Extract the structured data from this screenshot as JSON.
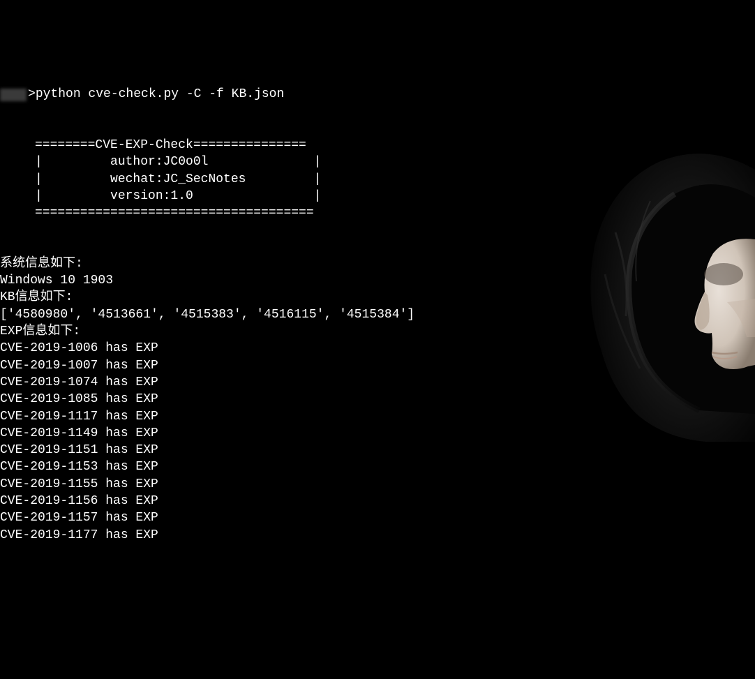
{
  "prompt": {
    "arrow": ">",
    "command": "python cve-check.py -C -f KB.json"
  },
  "banner": {
    "line1": "========CVE-EXP-Check===============",
    "line2": "|         author:JC0o0l              |",
    "line3": "|         wechat:JC_SecNotes         |",
    "line4": "|         version:1.0                |",
    "line5": "====================================="
  },
  "info": {
    "sysinfo_label": "系统信息如下:",
    "sysinfo_value": "Windows 10 1903",
    "kbinfo_label": "KB信息如下:",
    "kb_list": "['4580980', '4513661', '4515383', '4516115', '4515384']",
    "expinfo_label": "EXP信息如下:"
  },
  "exp_results": [
    "CVE-2019-1006 has EXP",
    "CVE-2019-1007 has EXP",
    "CVE-2019-1074 has EXP",
    "CVE-2019-1085 has EXP",
    "CVE-2019-1117 has EXP",
    "CVE-2019-1149 has EXP",
    "CVE-2019-1151 has EXP",
    "CVE-2019-1153 has EXP",
    "CVE-2019-1155 has EXP",
    "CVE-2019-1156 has EXP",
    "CVE-2019-1157 has EXP",
    "CVE-2019-1177 has EXP"
  ]
}
